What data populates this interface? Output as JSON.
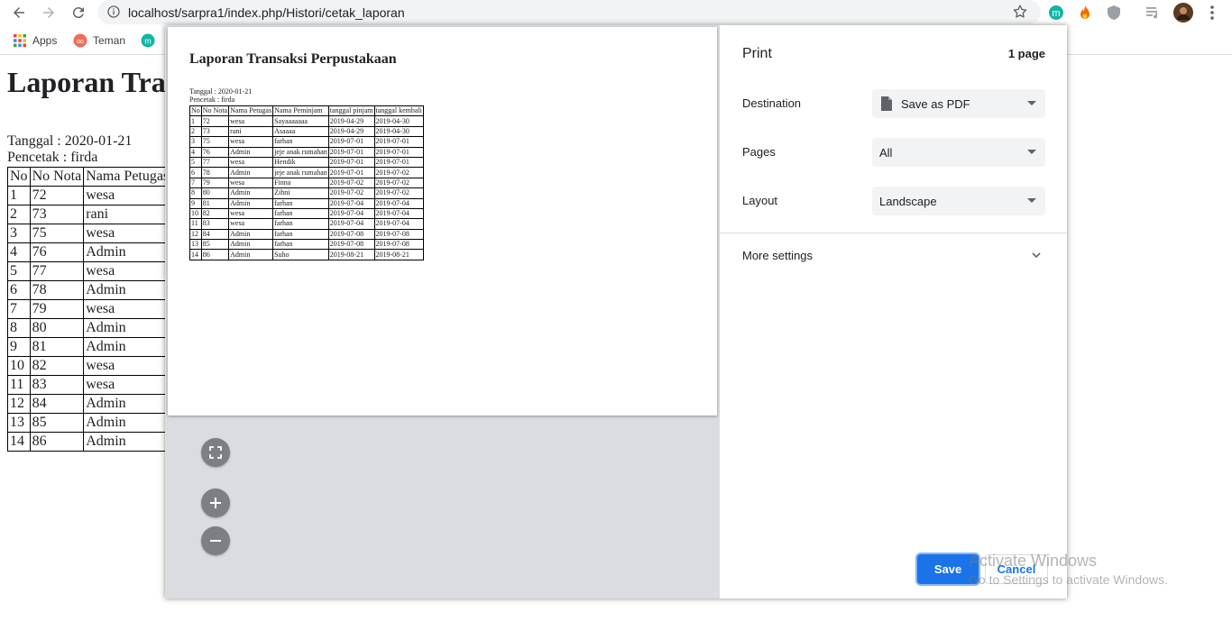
{
  "browser": {
    "url": "localhost/sarpra1/index.php/Histori/cetak_laporan",
    "bookmarks": [
      {
        "label": "Apps",
        "icon": "apps-grid-icon"
      },
      {
        "label": "Teman",
        "icon": "teman-icon"
      },
      {
        "label": "",
        "icon": "m-icon"
      }
    ]
  },
  "page": {
    "title": "Laporan Transaksi Perpustakaan",
    "date_line": "Tanggal : 2020-01-21",
    "printer_line": "Pencetak : firda",
    "columns": [
      "No",
      "No Nota",
      "Nama Petugas",
      "Nama Peminjam",
      "tanggal pinjam",
      "tanggal kembali"
    ],
    "rows": [
      [
        "1",
        "72",
        "wesa",
        "Sayaaaaaaa",
        "2019-04-29",
        "2019-04-30"
      ],
      [
        "2",
        "73",
        "rani",
        "Asaaaa",
        "2019-04-29",
        "2019-04-30"
      ],
      [
        "3",
        "75",
        "wesa",
        "farhan",
        "2019-07-01",
        "2019-07-01"
      ],
      [
        "4",
        "76",
        "Admin",
        "jeje anak rumahan",
        "2019-07-01",
        "2019-07-01"
      ],
      [
        "5",
        "77",
        "wesa",
        "Hendik",
        "2019-07-01",
        "2019-07-01"
      ],
      [
        "6",
        "78",
        "Admin",
        "jeje anak rumahan",
        "2019-07-01",
        "2019-07-02"
      ],
      [
        "7",
        "79",
        "wesa",
        "Finna",
        "2019-07-02",
        "2019-07-02"
      ],
      [
        "8",
        "80",
        "Admin",
        "Zihni",
        "2019-07-02",
        "2019-07-02"
      ],
      [
        "9",
        "81",
        "Admin",
        "farhan",
        "2019-07-04",
        "2019-07-04"
      ],
      [
        "10",
        "82",
        "wesa",
        "farhan",
        "2019-07-04",
        "2019-07-04"
      ],
      [
        "11",
        "83",
        "wesa",
        "farhan",
        "2019-07-04",
        "2019-07-04"
      ],
      [
        "12",
        "84",
        "Admin",
        "farhan",
        "2019-07-08",
        "2019-07-08"
      ],
      [
        "13",
        "85",
        "Admin",
        "farhan",
        "2019-07-08",
        "2019-07-08"
      ],
      [
        "14",
        "86",
        "Admin",
        "Suho",
        "2019-08-21",
        "2019-08-21"
      ]
    ]
  },
  "print": {
    "title": "Print",
    "page_count": "1 page",
    "destination_label": "Destination",
    "destination_value": "Save as PDF",
    "pages_label": "Pages",
    "pages_value": "All",
    "layout_label": "Layout",
    "layout_value": "Landscape",
    "more_settings": "More settings",
    "save": "Save",
    "cancel": "Cancel"
  },
  "watermark": {
    "line1": "Activate Windows",
    "line2": "Go to Settings to activate Windows."
  },
  "colors": {
    "accent": "#1a73e8",
    "preview_bg": "#dadce0",
    "zoom_button": "#7c7f84"
  }
}
